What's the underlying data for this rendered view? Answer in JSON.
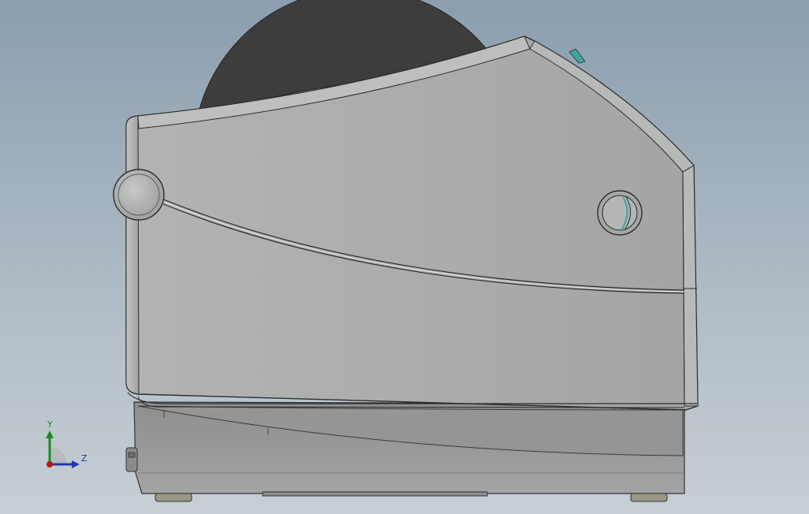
{
  "viewport": {
    "background_top": "#8b9eaf",
    "background_bottom": "#c7ced4"
  },
  "model": {
    "body_color": "#a9aaaa",
    "base_color": "#9c9d9e",
    "roll_color": "#3d3d3d",
    "accent_color": "#3aa9a3"
  },
  "triad": {
    "y_label": "Y",
    "z_label": "Z",
    "y_color": "#1d8a1d",
    "z_color": "#1e3aa8",
    "x_color": "#c01010"
  }
}
